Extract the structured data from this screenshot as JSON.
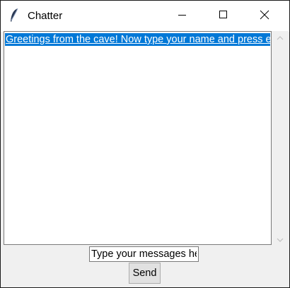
{
  "window": {
    "title": "Chatter",
    "icon": "feather-icon"
  },
  "controls": {
    "minimize_icon": "minimize-icon",
    "maximize_icon": "maximize-icon",
    "close_icon": "close-icon"
  },
  "messages": {
    "items": [
      {
        "text": "Greetings from the cave! Now type your name and press enter!",
        "selected": true
      }
    ],
    "selection_color": "#0078d7"
  },
  "entry": {
    "value": "Type your messages here."
  },
  "send": {
    "label": "Send"
  }
}
